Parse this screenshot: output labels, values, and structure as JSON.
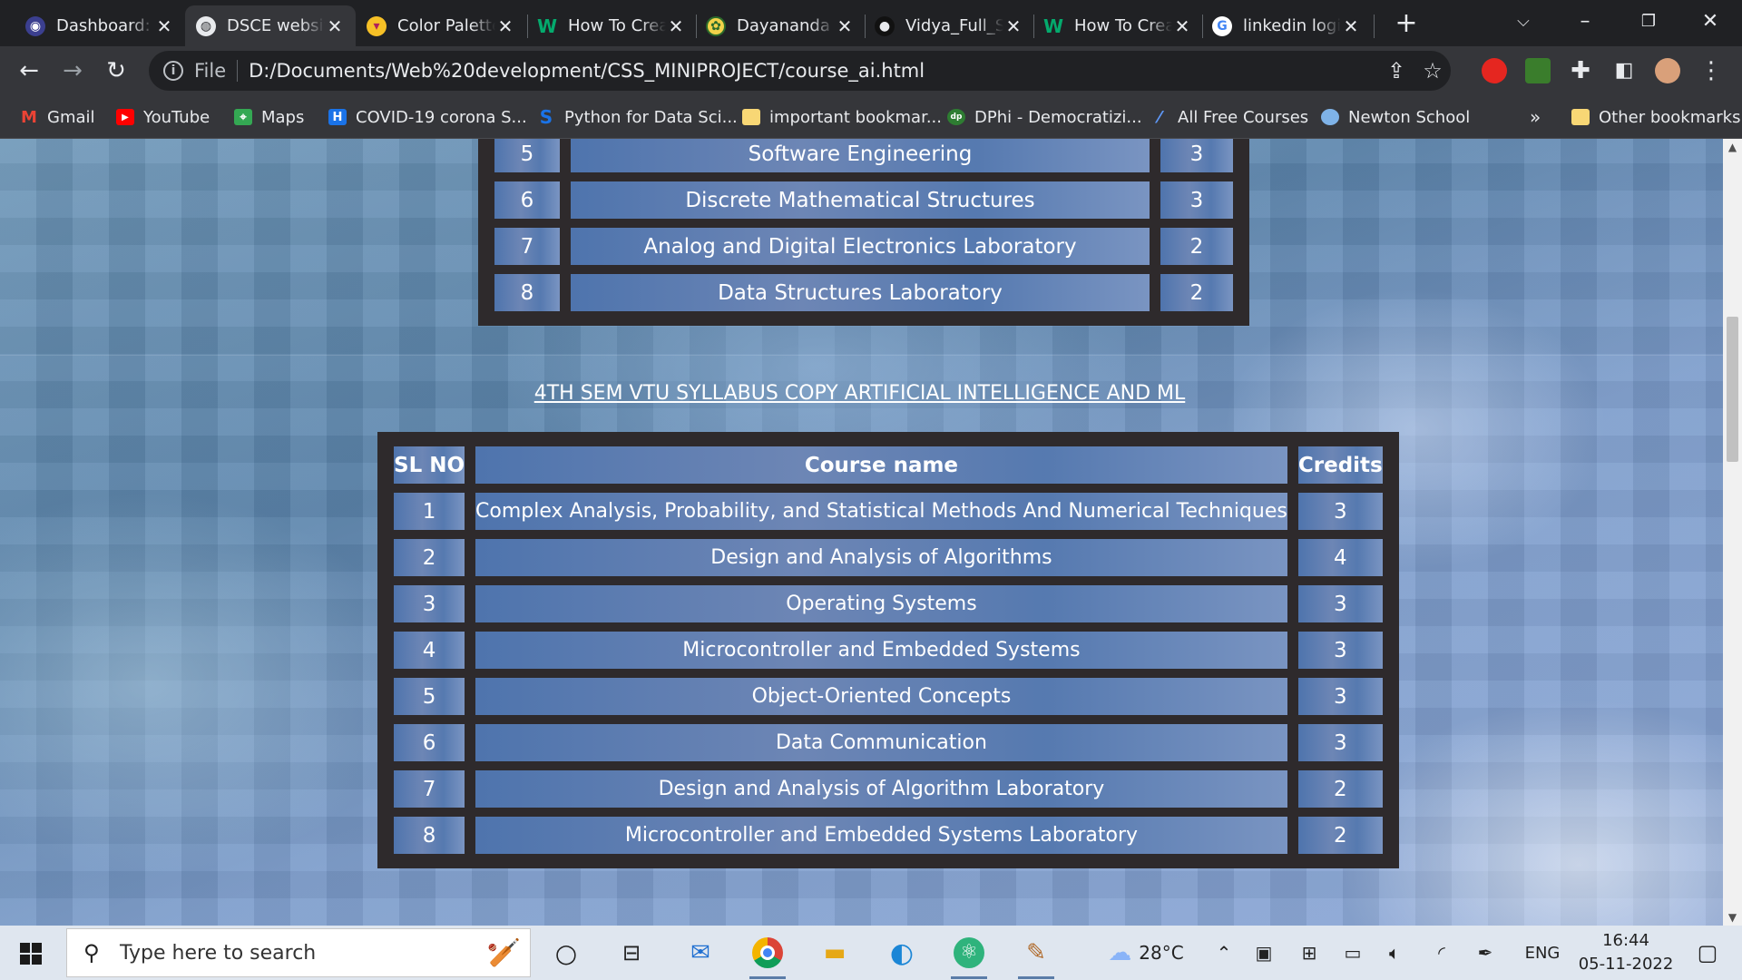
{
  "browser": {
    "tabs": [
      {
        "title": "Dashboard: Home",
        "favicon": "dashboard-favicon",
        "active": false
      },
      {
        "title": "DSCE website",
        "favicon": "globe-favicon",
        "active": true
      },
      {
        "title": "Color Palette Generator",
        "favicon": "palette-favicon",
        "active": false
      },
      {
        "title": "How To Create",
        "favicon": "w3schools-favicon",
        "active": false
      },
      {
        "title": "Dayananda Sagar",
        "favicon": "college-favicon",
        "active": false
      },
      {
        "title": "Vidya_Full_Stack",
        "favicon": "github-favicon",
        "active": false
      },
      {
        "title": "How To Create",
        "favicon": "w3schools-favicon",
        "active": false
      },
      {
        "title": "linkedin login",
        "favicon": "google-favicon",
        "active": false
      }
    ],
    "address": {
      "scheme": "File",
      "url": "D:/Documents/Web%20development/CSS_MINIPROJECT/course_ai.html"
    },
    "bookmarks": [
      {
        "label": "Gmail",
        "icon": "gmail-icon"
      },
      {
        "label": "YouTube",
        "icon": "youtube-icon"
      },
      {
        "label": "Maps",
        "icon": "maps-icon"
      },
      {
        "label": "COVID-19 corona S...",
        "icon": "covid-icon"
      },
      {
        "label": "Python for Data Sci...",
        "icon": "python-icon"
      },
      {
        "label": "important bookmar...",
        "icon": "folder-icon"
      },
      {
        "label": "DPhi - Democratizi...",
        "icon": "dphi-icon"
      },
      {
        "label": "All Free Courses",
        "icon": "courses-icon"
      },
      {
        "label": "Newton School",
        "icon": "newton-icon"
      }
    ],
    "bookmarks_overflow": "»",
    "other_bookmarks": "Other bookmarks"
  },
  "page": {
    "table1": {
      "partial_row": {
        "sl": "5",
        "name": "Software Engineering",
        "credits": "3"
      },
      "rows": [
        {
          "sl": "6",
          "name": "Discrete Mathematical Structures",
          "credits": "3"
        },
        {
          "sl": "7",
          "name": "Analog and Digital Electronics Laboratory",
          "credits": "2"
        },
        {
          "sl": "8",
          "name": "Data Structures Laboratory",
          "credits": "2"
        }
      ]
    },
    "heading": "4TH SEM VTU SYLLABUS COPY ARTIFICIAL INTELLIGENCE AND ML",
    "table2": {
      "headers": {
        "sl": "SL NO",
        "name": "Course name",
        "credits": "Credits"
      },
      "rows": [
        {
          "sl": "1",
          "name": "Complex Analysis, Probability, and Statistical Methods And Numerical Techniques",
          "credits": "3"
        },
        {
          "sl": "2",
          "name": "Design and Analysis of Algorithms",
          "credits": "4"
        },
        {
          "sl": "3",
          "name": "Operating Systems",
          "credits": "3"
        },
        {
          "sl": "4",
          "name": "Microcontroller and Embedded Systems",
          "credits": "3"
        },
        {
          "sl": "5",
          "name": "Object-Oriented Concepts",
          "credits": "3"
        },
        {
          "sl": "6",
          "name": "Data Communication",
          "credits": "3"
        },
        {
          "sl": "7",
          "name": "Design and Analysis of Algorithm Laboratory",
          "credits": "2"
        },
        {
          "sl": "8",
          "name": "Microcontroller and Embedded Systems Laboratory",
          "credits": "2"
        }
      ]
    }
  },
  "taskbar": {
    "search_placeholder": "Type here to search",
    "weather": "28°C",
    "language": "ENG",
    "time": "16:44",
    "date": "05-11-2022"
  },
  "colors": {
    "accent": "#5b7da8",
    "table_frame": "#2e2a2c",
    "chrome_dark": "#202124",
    "chrome_mid": "#35363a"
  }
}
